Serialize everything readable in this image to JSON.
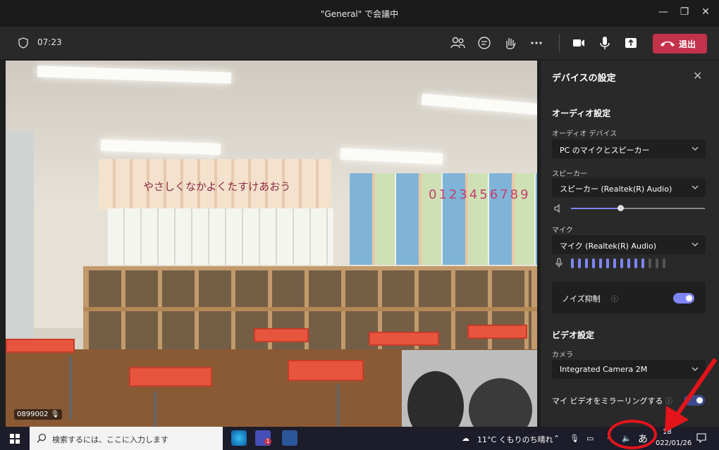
{
  "window": {
    "title": "\"General\" で会議中",
    "minimize_icon": "minimize-icon",
    "restore_icon": "restore-icon",
    "close_icon": "close-icon"
  },
  "meeting_bar": {
    "timer": "07:23",
    "leave_label": "退出",
    "icons": [
      "participants-icon",
      "chat-icon",
      "raise-hand-icon",
      "more-icon",
      "camera-icon",
      "mic-icon",
      "share-icon",
      "phone-hangup-icon"
    ],
    "leave_color": "#c4314b"
  },
  "video": {
    "banner_text": "やさしくなかよくたすけあおう",
    "numbers_text": "0123456789",
    "participant_name": "0899002"
  },
  "device_settings": {
    "title": "デバイスの設定",
    "audio_section": "オーディオ設定",
    "audio_device_label": "オーディオ デバイス",
    "audio_device_value": "PC のマイクとスピーカー",
    "speaker_label": "スピーカー",
    "speaker_value": "スピーカー (Realtek(R) Audio)",
    "speaker_volume": 0.37,
    "mic_label": "マイク",
    "mic_value": "マイク (Realtek(R) Audio)",
    "mic_level_bars": 11,
    "mic_level_total": 14,
    "noise_label": "ノイズ抑制",
    "noise_on": true,
    "video_section": "ビデオ設定",
    "camera_label": "カメラ",
    "camera_value": "Integrated Camera 2M",
    "mirror_label": "マイ ビデオをミラーリングする",
    "accent_color": "#7f85f5"
  },
  "taskbar": {
    "search_placeholder": "検索するには、ここに入力します",
    "weather": "11°C くもりのち晴れ",
    "ime": "あ",
    "time": "18",
    "date": "022/01/26",
    "teams_badge": "1"
  }
}
